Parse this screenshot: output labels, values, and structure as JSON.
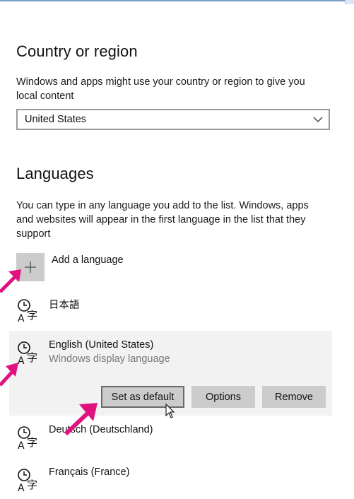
{
  "region": {
    "heading": "Country or region",
    "description": "Windows and apps might use your country or region to give you local content",
    "selected_country": "United States"
  },
  "languages": {
    "heading": "Languages",
    "description": "You can type in any language you add to the list. Windows, apps and websites will appear in the first language in the list that they support",
    "add_label": "Add a language",
    "items": [
      {
        "name": "日本語",
        "sub": ""
      },
      {
        "name": "English (United States)",
        "sub": "Windows display language"
      },
      {
        "name": "Deutsch (Deutschland)",
        "sub": ""
      },
      {
        "name": "Français (France)",
        "sub": ""
      }
    ],
    "actions": {
      "set_default": "Set as default",
      "options": "Options",
      "remove": "Remove"
    }
  },
  "icons": {
    "add": "plus-icon",
    "language": "language-pack-icon",
    "dropdown": "chevron-down-icon",
    "annotation": "magenta-arrow"
  },
  "colors": {
    "annotation_arrow": "#e0127f",
    "selected_row": "#f2f2f2",
    "button": "#cccccc"
  }
}
